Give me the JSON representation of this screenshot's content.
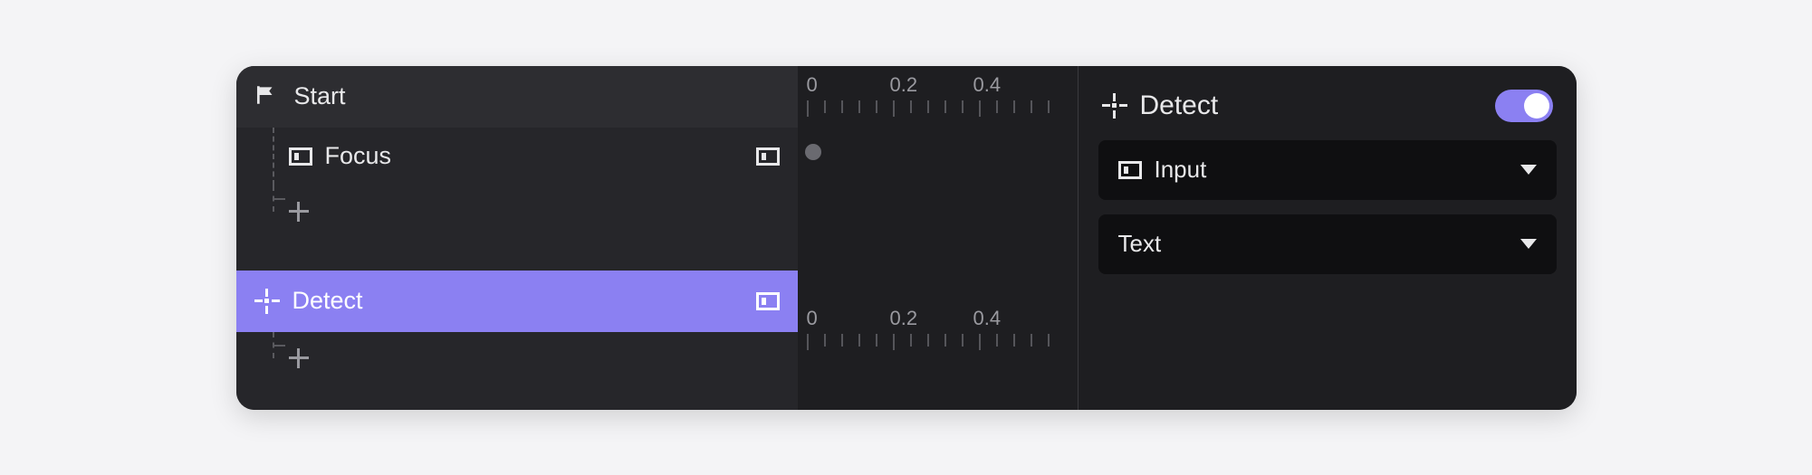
{
  "tree": {
    "start": {
      "label": "Start"
    },
    "focus": {
      "label": "Focus"
    },
    "detect": {
      "label": "Detect"
    }
  },
  "timeline": {
    "ticks": [
      "0",
      "0.2",
      "0.4"
    ]
  },
  "inspector": {
    "title": "Detect",
    "enabled": true,
    "input_select": "Input",
    "type_select": "Text"
  }
}
